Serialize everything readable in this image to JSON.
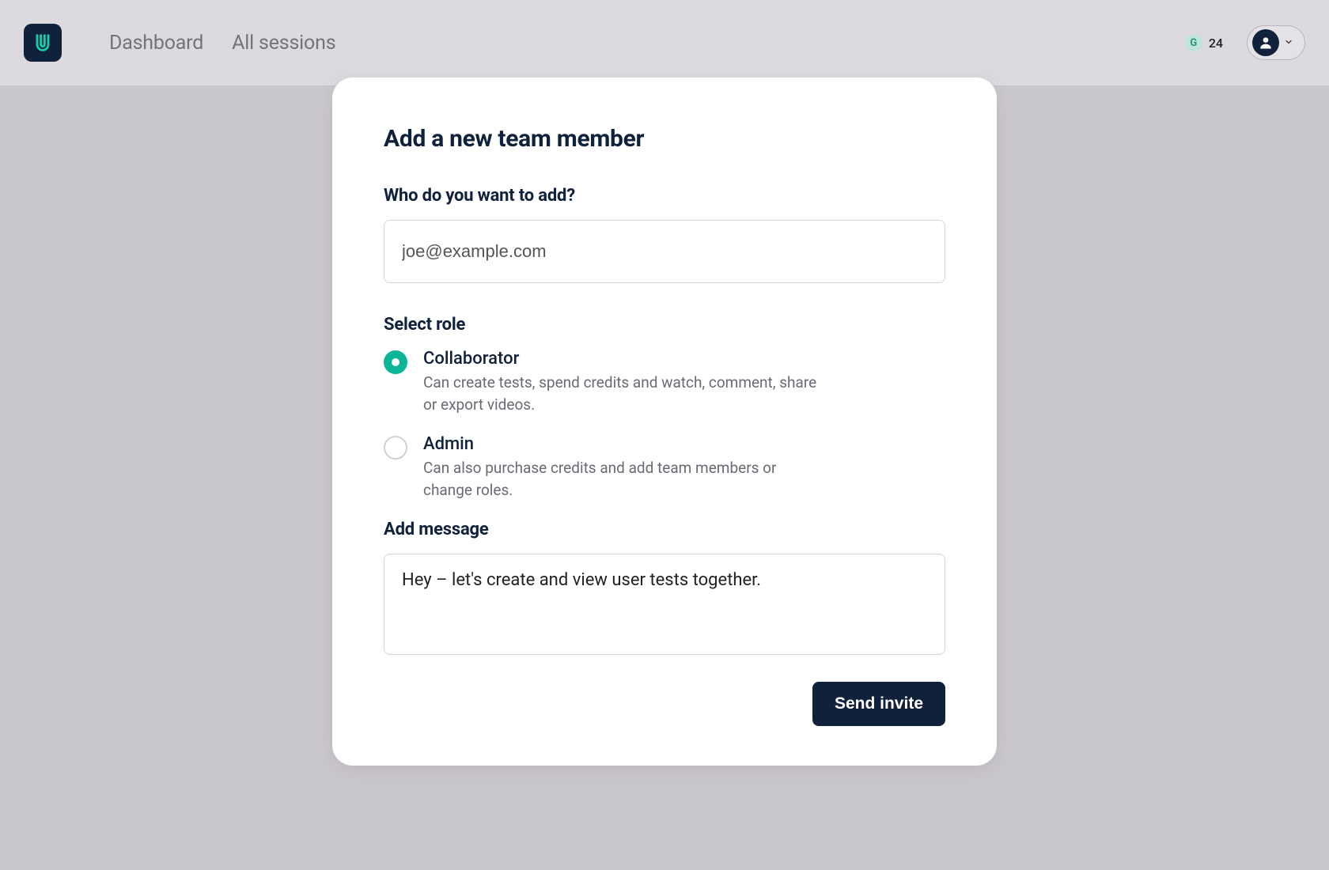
{
  "header": {
    "nav": {
      "dashboard": "Dashboard",
      "all_sessions": "All sessions"
    },
    "credits": {
      "count": "24",
      "glyph": "G"
    }
  },
  "modal": {
    "title": "Add a new team member",
    "who_label": "Who do you want to add?",
    "email_placeholder": "joe@example.com",
    "role_label": "Select role",
    "roles": [
      {
        "title": "Collaborator",
        "desc": "Can create tests, spend credits and watch, comment, share or export videos.",
        "selected": true
      },
      {
        "title": "Admin",
        "desc": "Can also purchase credits and add team members or change roles.",
        "selected": false
      }
    ],
    "message_label": "Add message",
    "message_value": "Hey – let's create and view user tests together.",
    "send_label": "Send invite"
  }
}
